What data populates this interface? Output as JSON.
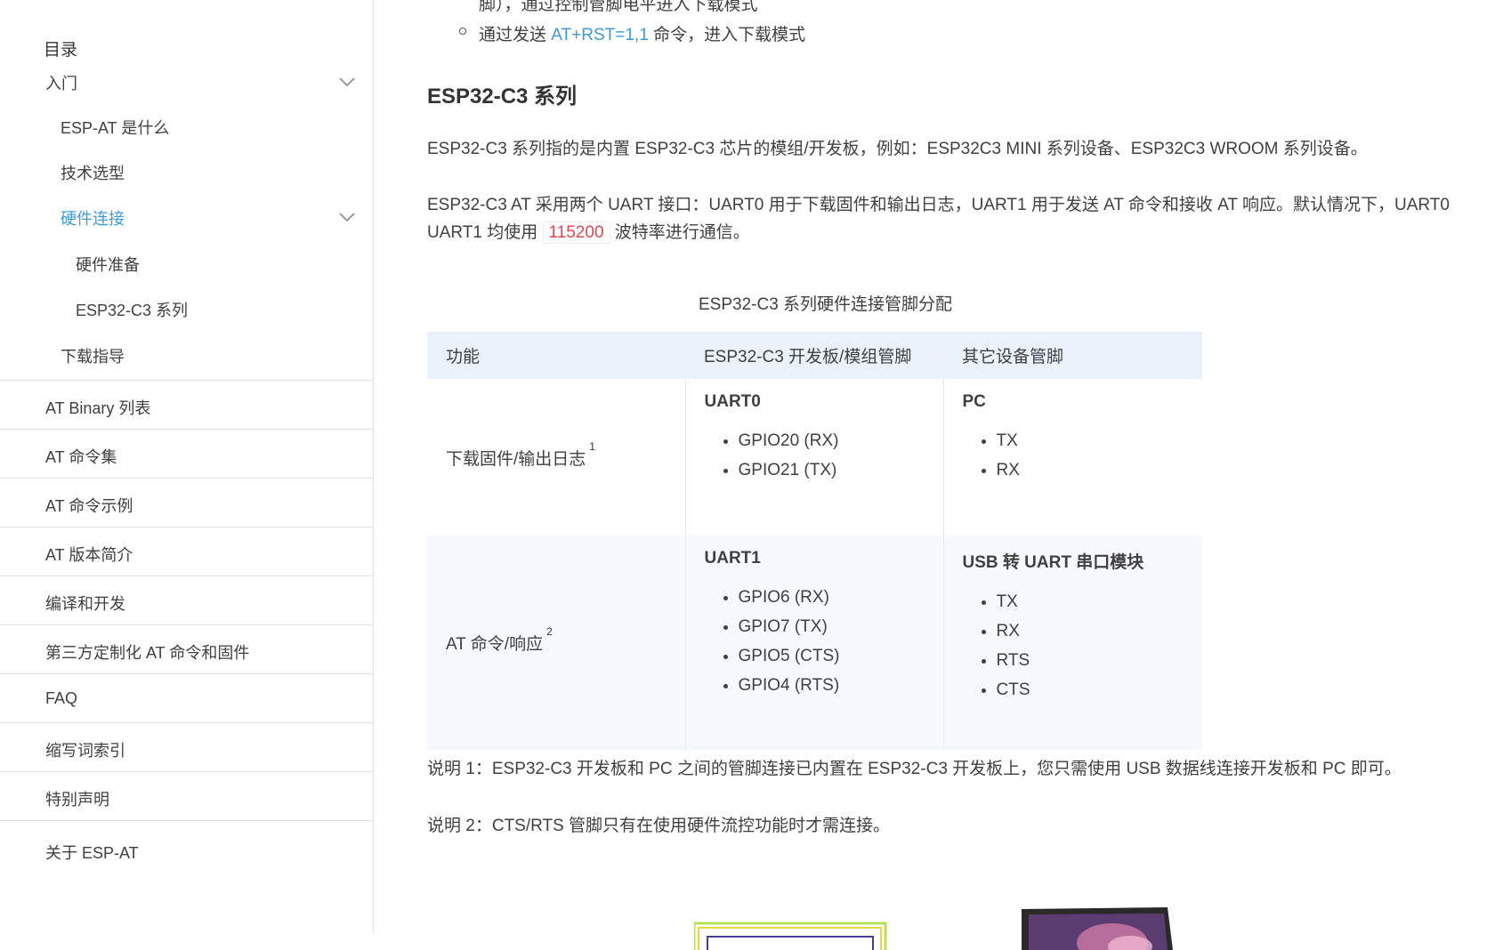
{
  "sidebar": {
    "toc_title": "目录",
    "items": [
      {
        "label": "入门"
      },
      {
        "label": "ESP-AT 是什么"
      },
      {
        "label": "技术选型"
      },
      {
        "label": "硬件连接"
      },
      {
        "label": "硬件准备"
      },
      {
        "label": "ESP32-C3 系列"
      },
      {
        "label": "下载指导"
      },
      {
        "label": "AT Binary 列表"
      },
      {
        "label": "AT 命令集"
      },
      {
        "label": "AT 命令示例"
      },
      {
        "label": "AT 版本简介"
      },
      {
        "label": "编译和开发"
      },
      {
        "label": "第三方定制化 AT 命令和固件"
      },
      {
        "label": "FAQ"
      },
      {
        "label": "缩写词索引"
      },
      {
        "label": "特别声明"
      },
      {
        "label": "关于 ESP-AT"
      }
    ]
  },
  "main": {
    "cut_line": "脚），通过控制管脚电平进入下载模式",
    "bullet_prefix": "通过发送",
    "bullet_link": "AT+RST=1,1",
    "bullet_suffix": "命令，进入下载模式",
    "section_title": "ESP32-C3 系列",
    "para1": "ESP32-C3 系列指的是内置 ESP32-C3 芯片的模组/开发板，例如：ESP32C3 MINI 系列设备、ESP32C3 WROOM 系列设备。",
    "para2_line1": "ESP32-C3 AT 采用两个 UART 接口：UART0 用于下载固件和输出日志，UART1 用于发送 AT 命令和接收 AT 响应。默认情况下，UART0",
    "para2_line2_prefix": "UART1 均使用",
    "para2_code": "115200",
    "para2_line2_suffix": "波特率进行通信。",
    "table_caption": "ESP32-C3 系列硬件连接管脚分配",
    "table": {
      "headers": [
        "功能",
        "ESP32-C3 开发板/模组管脚",
        "其它设备管脚"
      ],
      "rows": [
        {
          "function": "下载固件/输出日志",
          "footnote": "1",
          "board_head": "UART0",
          "board_pins": [
            "GPIO20 (RX)",
            "GPIO21 (TX)"
          ],
          "other_head": "PC",
          "other_pins": [
            "TX",
            "RX"
          ]
        },
        {
          "function": "AT 命令/响应",
          "footnote": "2",
          "board_head": "UART1",
          "board_pins": [
            "GPIO6 (RX)",
            "GPIO7 (TX)",
            "GPIO5 (CTS)",
            "GPIO4 (RTS)"
          ],
          "other_head": "USB 转 UART 串口模块",
          "other_pins": [
            "TX",
            "RX",
            "RTS",
            "CTS"
          ]
        }
      ]
    },
    "note1": "说明 1：ESP32-C3 开发板和 PC 之间的管脚连接已内置在 ESP32-C3 开发板上，您只需使用 USB 数据线连接开发板和 PC 即可。",
    "note2": "说明 2：CTS/RTS 管脚只有在使用硬件流控功能时才需连接。"
  },
  "colors": {
    "link": "#3e9ade",
    "code": "#e0474f",
    "table_header_bg": "#e9f1fb",
    "table_alt_bg": "#f5f8fc"
  }
}
